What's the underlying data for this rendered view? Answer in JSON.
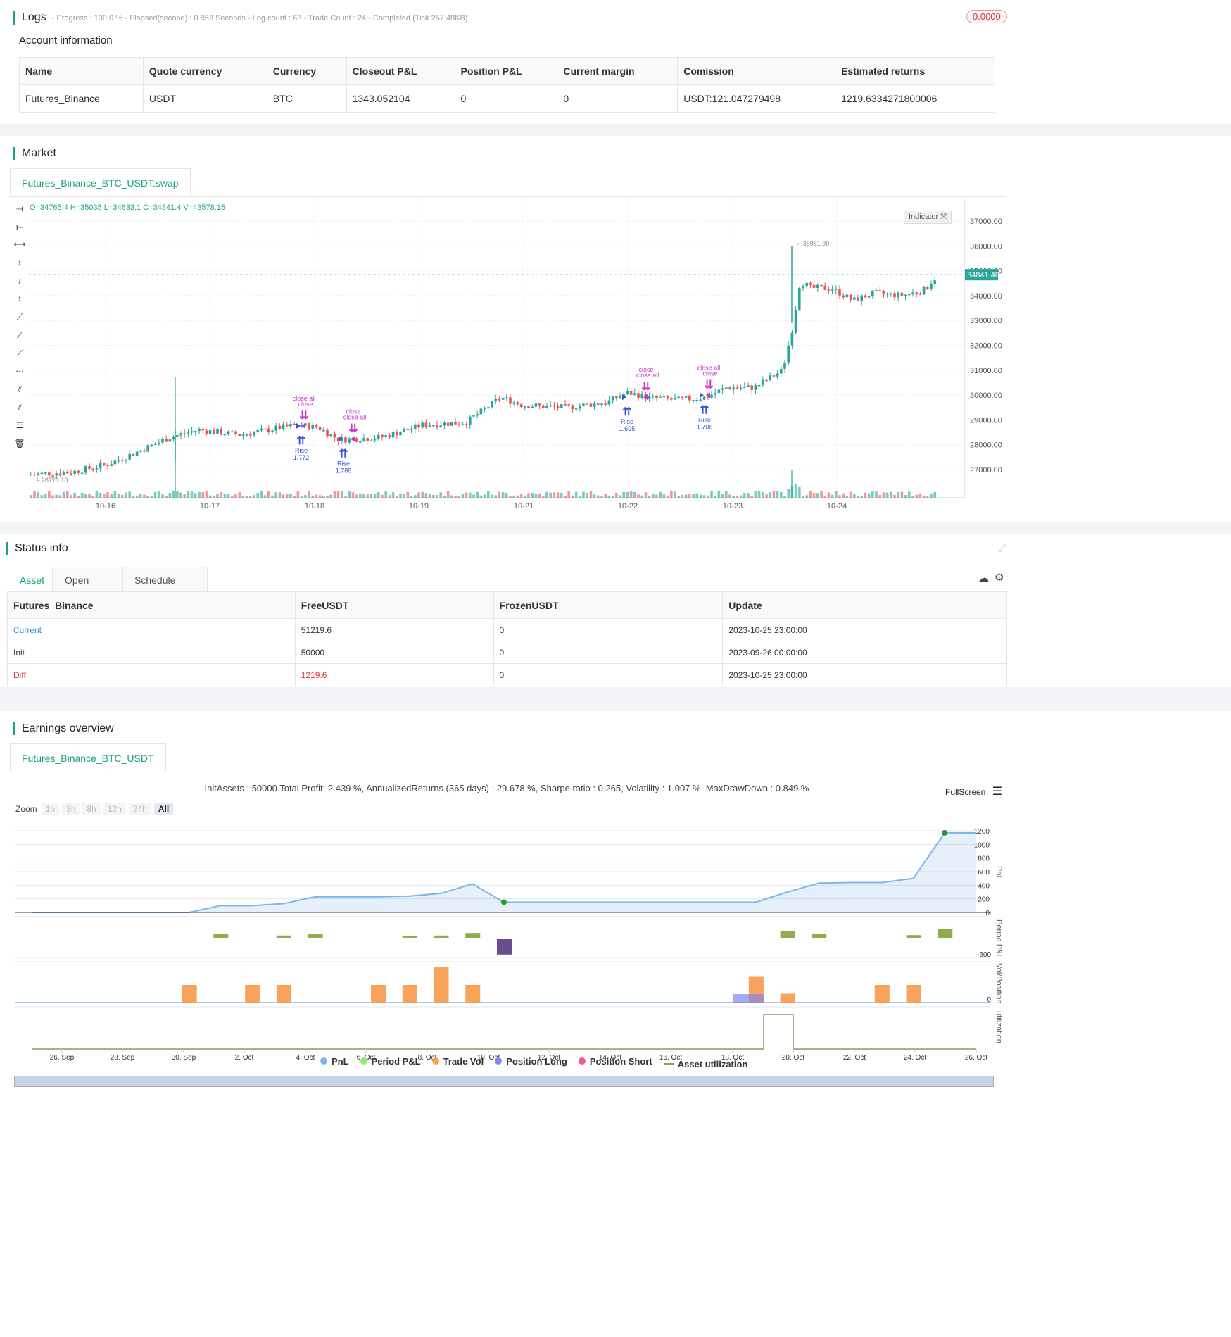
{
  "logs": {
    "title": "Logs",
    "progress": "- Progress : 100.0 % - Elapsed(second) : 0.853 Seconds - Log count : 63 - Trade Count : 24 - Completed (Tick 257.48KB)",
    "badge": "0.0000"
  },
  "account": {
    "title": "Account information",
    "columns": [
      "Name",
      "Quote currency",
      "Currency",
      "Closeout P&L",
      "Position P&L",
      "Current margin",
      "Comission",
      "Estimated returns"
    ],
    "row": [
      "Futures_Binance",
      "USDT",
      "BTC",
      "1343.052104",
      "0",
      "0",
      "USDT:121.047279498",
      "1219.6334271800006"
    ]
  },
  "market": {
    "title": "Market",
    "tab": "Futures_Binance_BTC_USDT:swap",
    "ohlc": "O=34765.4 H=35035 L=34633.1 C=34841.4 V=43578.15",
    "indicator_label": "Indicator",
    "last_price": "34841.40",
    "high_label": "35981.90",
    "low_label": "26773.10",
    "y_ticks": [
      "37000.00",
      "36000.00",
      "35000.00",
      "34000.00",
      "33000.00",
      "32000.00",
      "31000.00",
      "30000.00",
      "29000.00",
      "28000.00",
      "27000.00"
    ],
    "x_ticks": [
      "10-16",
      "10-17",
      "10-18",
      "10-19",
      "10-21",
      "10-22",
      "10-23",
      "10-24"
    ],
    "signals": [
      {
        "text": "close all",
        "text2": "close",
        "buy": "Rise",
        "buy_val": "1.772"
      },
      {
        "text": "close",
        "text2": "close all",
        "buy": "Rise",
        "buy_val": "1.788"
      },
      {
        "text": "close",
        "text2": "close all",
        "buy": "Rise",
        "buy_val": "1.695"
      },
      {
        "text": "close all",
        "text2": "close",
        "buy": "Rise",
        "buy_val": "1.706"
      }
    ],
    "colors": {
      "up": "#26a69a",
      "down": "#ef5350",
      "signal": "#cc33cc",
      "buy": "#3355dd"
    }
  },
  "status": {
    "title": "Status info",
    "tabs": [
      "Asset",
      "Open orders",
      "Schedule orders"
    ],
    "columns": [
      "Futures_Binance",
      "FreeUSDT",
      "FrozenUSDT",
      "Update"
    ],
    "rows": [
      {
        "name": "Current",
        "free": "51219.6",
        "frozen": "0",
        "update": "2023-10-25 23:00:00"
      },
      {
        "name": "Init",
        "free": "50000",
        "frozen": "0",
        "update": "2023-09-26 00:00:00"
      },
      {
        "name": "Diff",
        "free": "1219.6",
        "frozen": "0",
        "update": "2023-10-25 23:00:00"
      }
    ]
  },
  "earnings": {
    "title": "Earnings overview",
    "tab": "Futures_Binance_BTC_USDT",
    "summary": "InitAssets : 50000 Total Profit: 2.439 %, AnnualizedReturns (365 days) : 29.678 %, Sharpe ratio : 0.265, Volatility : 1.007 %, MaxDrawDown : 0.849 %",
    "fullscreen": "FullScreen",
    "zoom_label": "Zoom",
    "zoom_buttons": [
      "1h",
      "3h",
      "8h",
      "12h",
      "24h",
      "All"
    ],
    "pnl_ticks": [
      "1200",
      "1000",
      "800",
      "600",
      "400",
      "200",
      "0"
    ],
    "period_tick": "-600",
    "vol_tick": "0",
    "axis_labels": {
      "pnl": "PnL",
      "period": "Period P&L",
      "vol": "Vol/Position",
      "util": "utilization"
    },
    "x_ticks": [
      "26. Sep",
      "28. Sep",
      "30. Sep",
      "2. Oct",
      "4. Oct",
      "6. Oct",
      "8. Oct",
      "10. Oct",
      "12. Oct",
      "14. Oct",
      "16. Oct",
      "18. Oct",
      "20. Oct",
      "22. Oct",
      "24. Oct",
      "26. Oct"
    ],
    "legend": [
      {
        "name": "PnL",
        "color": "#7cb5ec"
      },
      {
        "name": "Period P&L",
        "color": "#90ed7d"
      },
      {
        "name": "Trade Vol",
        "color": "#f7a35c"
      },
      {
        "name": "Position Long",
        "color": "#8085e9"
      },
      {
        "name": "Position Short",
        "color": "#f15c80"
      },
      {
        "name": "Asset utilization",
        "color": "#a09060"
      }
    ],
    "chart_data": {
      "type": "area",
      "pnl": [
        0,
        0,
        0,
        0,
        0,
        0,
        100,
        100,
        130,
        230,
        230,
        230,
        240,
        280,
        420,
        150,
        150,
        150,
        150,
        150,
        150,
        150,
        150,
        150,
        300,
        430,
        440,
        440,
        500,
        1170,
        1170
      ],
      "period_pnl": [
        0,
        0,
        0,
        0,
        0,
        0,
        50,
        0,
        20,
        60,
        0,
        0,
        10,
        20,
        80,
        -330,
        0,
        0,
        0,
        0,
        0,
        0,
        0,
        0,
        120,
        60,
        0,
        0,
        30,
        180,
        0
      ],
      "trade_vol": [
        0,
        0,
        0,
        0,
        0,
        1,
        0,
        1,
        1,
        0,
        0,
        1,
        1,
        2,
        1,
        0,
        0,
        0,
        0,
        0,
        0,
        0,
        0,
        1.5,
        0.5,
        0,
        0,
        1,
        1,
        0,
        0
      ]
    }
  }
}
